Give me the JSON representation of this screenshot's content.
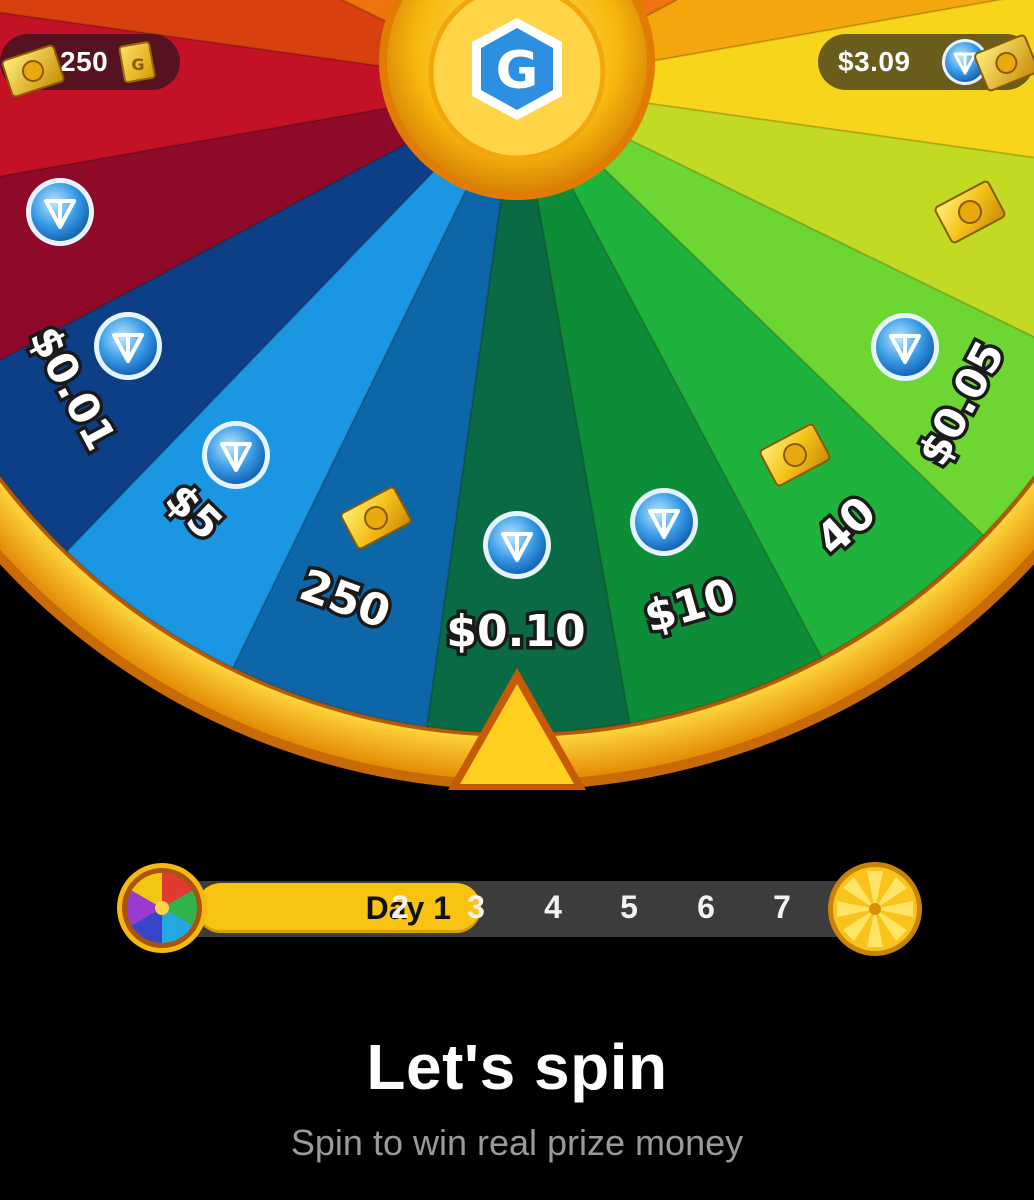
{
  "header": {
    "tickets_balance": "250",
    "ticket_badge_letter": "G",
    "usd_balance": "$3.09",
    "logo_letter": "G",
    "ton_icon": "ton-coin-icon",
    "ticket_icon": "golden-ticket-icon"
  },
  "wheel": {
    "segments": [
      {
        "label": "$0.01",
        "icon": "ton-coin-icon"
      },
      {
        "label": "$5",
        "icon": "ton-coin-icon"
      },
      {
        "label": "250",
        "icon": "golden-ticket-icon"
      },
      {
        "label": "$0.10",
        "icon": "ton-coin-icon"
      },
      {
        "label": "$10",
        "icon": "ton-coin-icon"
      },
      {
        "label": "40",
        "icon": "golden-ticket-icon"
      },
      {
        "label": "$0.05",
        "icon": "ton-coin-icon"
      }
    ],
    "colors": [
      "#8e0a28",
      "#c31226",
      "#d8410f",
      "#ef7410",
      "#f6a60d",
      "#f7d51a",
      "#c3da24",
      "#6ed632",
      "#1fb23c",
      "#0e8d38",
      "#0a6a43",
      "#0d66a8",
      "#1a96e3",
      "#0c3f86"
    ]
  },
  "progress": {
    "active_label": "Day 1",
    "days": [
      "2",
      "3",
      "4",
      "5",
      "6",
      "7"
    ],
    "start_icon": "color-wheel-icon",
    "end_icon": "golden-wheel-icon"
  },
  "footer": {
    "title": "Let's spin",
    "subtitle": "Spin to win real prize money"
  }
}
